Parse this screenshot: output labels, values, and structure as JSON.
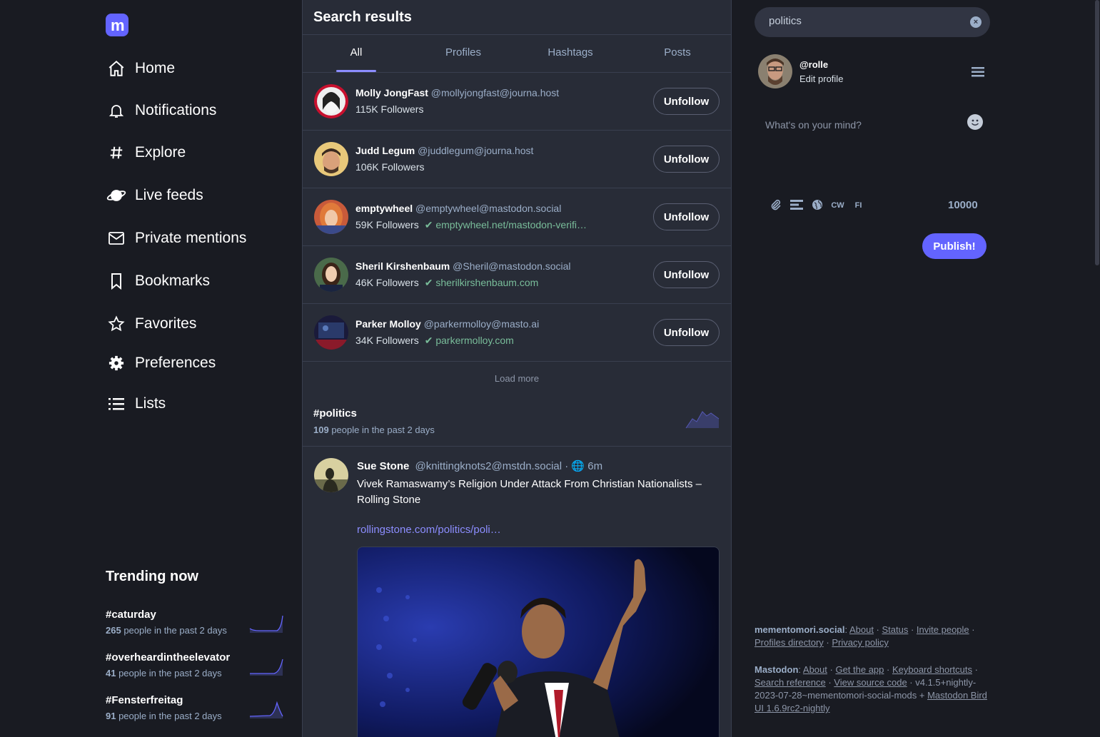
{
  "nav": {
    "items": [
      {
        "label": "Home",
        "icon": "home-icon"
      },
      {
        "label": "Notifications",
        "icon": "bell-icon"
      },
      {
        "label": "Explore",
        "icon": "hash-icon"
      },
      {
        "label": "Live feeds",
        "icon": "planet-icon"
      },
      {
        "label": "Private mentions",
        "icon": "envelope-icon"
      },
      {
        "label": "Bookmarks",
        "icon": "bookmark-icon"
      },
      {
        "label": "Favorites",
        "icon": "star-icon"
      },
      {
        "label": "Preferences",
        "icon": "gear-icon"
      },
      {
        "label": "Lists",
        "icon": "list-icon"
      }
    ]
  },
  "trending": {
    "title": "Trending now",
    "items": [
      {
        "tag": "#caturday",
        "count": "265",
        "suffix": " people in the past 2 days"
      },
      {
        "tag": "#overheardintheelevator",
        "count": "41",
        "suffix": " people in the past 2 days"
      },
      {
        "tag": "#Fensterfreitag",
        "count": "91",
        "suffix": " people in the past 2 days"
      }
    ]
  },
  "column": {
    "title": "Search results",
    "tabs": [
      {
        "label": "All",
        "active": true
      },
      {
        "label": "Profiles"
      },
      {
        "label": "Hashtags"
      },
      {
        "label": "Posts"
      }
    ]
  },
  "accounts": [
    {
      "name": "Molly JongFast",
      "handle": "@mollyjongfast@journa.host",
      "followers": "115K Followers",
      "verified": "",
      "button": "Unfollow"
    },
    {
      "name": "Judd Legum",
      "handle": "@juddlegum@journa.host",
      "followers": "106K Followers",
      "verified": "",
      "button": "Unfollow"
    },
    {
      "name": "emptywheel",
      "handle": "@emptywheel@mastodon.social",
      "followers": "59K Followers",
      "verified": "emptywheel.net/mastodon-verifi…",
      "button": "Unfollow"
    },
    {
      "name": "Sheril Kirshenbaum",
      "handle": "@Sheril@mastodon.social",
      "followers": "46K Followers",
      "verified": "sherilkirshenbaum.com",
      "button": "Unfollow"
    },
    {
      "name": "Parker Molloy",
      "handle": "@parkermolloy@masto.ai",
      "followers": "34K Followers",
      "verified": "parkermolloy.com",
      "button": "Unfollow"
    }
  ],
  "load_more": "Load more",
  "hashtag": {
    "tag": "#politics",
    "count": "109",
    "suffix": " people in the past 2 days"
  },
  "status": {
    "name": "Sue Stone",
    "handle": "@knittingknots2@mstdn.social",
    "sep": "·",
    "time": "6m",
    "text": "Vivek Ramaswamy’s Religion Under Attack From Christian Nationalists – Rolling Stone",
    "link": "rollingstone.com/politics/poli…"
  },
  "right": {
    "search_value": "politics",
    "me_handle": "@rolle",
    "edit_profile": "Edit profile",
    "compose_placeholder": "What's on your mind?",
    "cw": "CW",
    "lang": "FI",
    "counter": "10000",
    "publish": "Publish!"
  },
  "footer": {
    "server": "mementomori.social",
    "about": "About",
    "status": "Status",
    "invite": "Invite people",
    "directory": "Profiles directory",
    "privacy": "Privacy policy",
    "mastodon": "Mastodon",
    "m_about": "About",
    "get_app": "Get the app",
    "shortcuts": "Keyboard shortcuts",
    "search_ref": "Search reference",
    "source": "View source code",
    "version": "v4.1.5+nightly-2023-07-28~mementomori-social-mods +",
    "bird_ui": "Mastodon Bird UI 1.6.9rc2-nightly"
  },
  "colors": {
    "accent": "#6364ff",
    "verified": "#79bd9a",
    "link": "#8c8dff",
    "bg": "#191b22",
    "column": "#282c37"
  }
}
